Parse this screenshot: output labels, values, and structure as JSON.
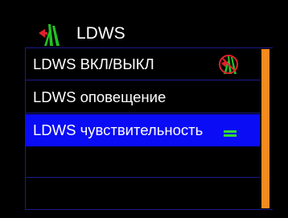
{
  "header": {
    "title": "LDWS",
    "icon": "lane-departure-icon"
  },
  "menu": {
    "items": [
      {
        "label": "LDWS ВКЛ/ВЫКЛ",
        "icon": "lane-departure-off-icon",
        "selected": false
      },
      {
        "label": "LDWS оповещение",
        "selected": false
      },
      {
        "label": "LDWS чувствительность",
        "icon": "sensitivity-level-icon",
        "selected": true
      },
      {
        "label": "",
        "selected": false
      },
      {
        "label": "",
        "selected": false
      }
    ]
  },
  "scrollbar": {
    "position_fraction": 0.0,
    "visible_fraction": 1.0
  },
  "colors": {
    "background": "#000000",
    "selection": "#0a0cf5",
    "row_border": "#1b1b8a",
    "scrollbar": "#f58a1f",
    "icon_green": "#22c022",
    "icon_red": "#e0202a",
    "level_green": "#33dd33"
  }
}
